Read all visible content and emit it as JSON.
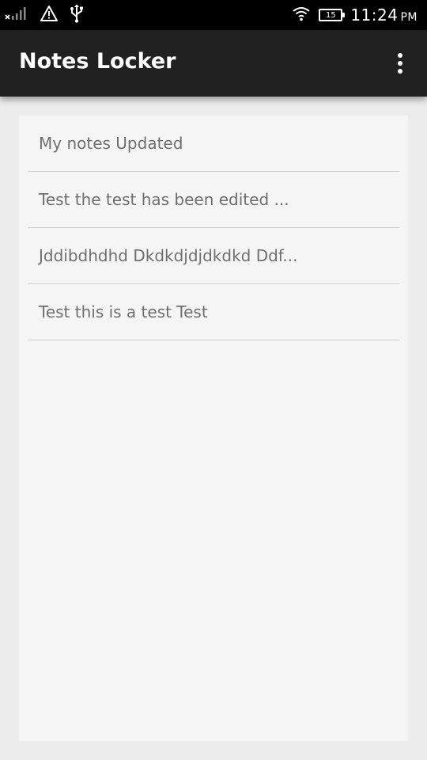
{
  "status_bar": {
    "time": "11:24",
    "ampm": "PM",
    "battery_level": "15",
    "icons": [
      "no-signal-icon",
      "warning-icon",
      "usb-icon",
      "wifi-icon",
      "battery-icon"
    ]
  },
  "app_bar": {
    "title": "Notes Locker",
    "menu_icon": "more-vert-icon"
  },
  "notes": [
    {
      "title": "My notes Updated"
    },
    {
      "title": "Test the test has been edited ..."
    },
    {
      "title": "Jddibdhdhd Dkdkdjdjdkdkd Ddf..."
    },
    {
      "title": "Test this is a test Test"
    }
  ],
  "colors": {
    "status_bar": "#000000",
    "app_bar": "#212121",
    "background": "#ececec",
    "card": "#f5f5f5",
    "note_text": "#6f6f6f",
    "divider": "#cfcfcf"
  }
}
